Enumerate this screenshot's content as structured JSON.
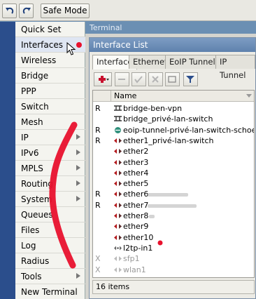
{
  "toolbar": {
    "undo_icon": "undo-icon",
    "redo_icon": "redo-icon",
    "safe_mode_label": "Safe Mode"
  },
  "sidebar": {
    "items": [
      {
        "label": "Quick Set",
        "submenu": false
      },
      {
        "label": "Interfaces",
        "submenu": false
      },
      {
        "label": "Wireless",
        "submenu": false
      },
      {
        "label": "Bridge",
        "submenu": false
      },
      {
        "label": "PPP",
        "submenu": false
      },
      {
        "label": "Switch",
        "submenu": false
      },
      {
        "label": "Mesh",
        "submenu": false
      },
      {
        "label": "IP",
        "submenu": true
      },
      {
        "label": "IPv6",
        "submenu": true
      },
      {
        "label": "MPLS",
        "submenu": true
      },
      {
        "label": "Routing",
        "submenu": true
      },
      {
        "label": "System",
        "submenu": true
      },
      {
        "label": "Queues",
        "submenu": false
      },
      {
        "label": "Files",
        "submenu": false
      },
      {
        "label": "Log",
        "submenu": false
      },
      {
        "label": "Radius",
        "submenu": false
      },
      {
        "label": "Tools",
        "submenu": true
      },
      {
        "label": "New Terminal",
        "submenu": false
      }
    ]
  },
  "terminal": {
    "title": "Terminal"
  },
  "window": {
    "title": "Interface List",
    "tabs": [
      {
        "label": "Interface"
      },
      {
        "label": "Ethernet"
      },
      {
        "label": "EoIP Tunnel"
      },
      {
        "label": "IP Tunnel"
      }
    ],
    "column_header": "Name",
    "rows": [
      {
        "flag": "R",
        "icon": "bridge-icon",
        "name": "bridge-ben-vpn",
        "disabled": false
      },
      {
        "flag": "",
        "icon": "bridge-icon",
        "name": "bridge_privé-lan-switch",
        "disabled": false
      },
      {
        "flag": "R",
        "icon": "eoip-icon",
        "name": "eoip-tunnel-privé-lan-switch-schoen",
        "disabled": false
      },
      {
        "flag": "R",
        "icon": "ethernet-icon",
        "name": "ether1_privé-lan-switch",
        "disabled": false
      },
      {
        "flag": "",
        "icon": "ethernet-icon",
        "name": "ether2",
        "disabled": false
      },
      {
        "flag": "",
        "icon": "ethernet-icon",
        "name": "ether3",
        "disabled": false
      },
      {
        "flag": "",
        "icon": "ethernet-icon",
        "name": "ether4",
        "disabled": false
      },
      {
        "flag": "",
        "icon": "ethernet-icon",
        "name": "ether5",
        "disabled": false
      },
      {
        "flag": "R",
        "icon": "ethernet-icon",
        "name": "ether6",
        "disabled": false
      },
      {
        "flag": "R",
        "icon": "ethernet-icon",
        "name": "ether7",
        "disabled": false
      },
      {
        "flag": "",
        "icon": "ethernet-icon",
        "name": "ether8",
        "disabled": false
      },
      {
        "flag": "",
        "icon": "ethernet-icon",
        "name": "ether9",
        "disabled": false
      },
      {
        "flag": "",
        "icon": "ethernet-icon",
        "name": "ether10",
        "disabled": false
      },
      {
        "flag": "",
        "icon": "l2tp-icon",
        "name": "l2tp-in1",
        "disabled": false
      },
      {
        "flag": "X",
        "icon": "sfp-icon",
        "name": "sfp1",
        "disabled": true
      },
      {
        "flag": "X",
        "icon": "wlan-icon",
        "name": "wlan1",
        "disabled": true
      }
    ],
    "status": "16 items"
  },
  "colors": {
    "accent_red": "#e8112d",
    "title_blue": "#5f82ad"
  }
}
